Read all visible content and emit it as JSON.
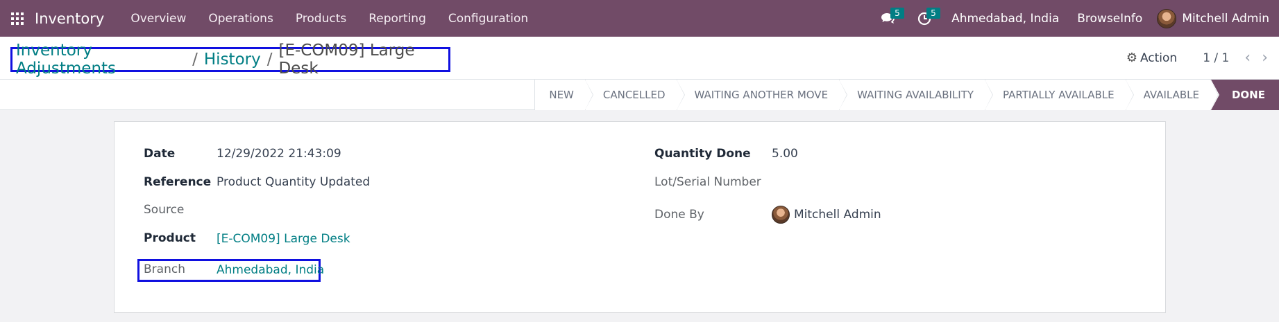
{
  "navbar": {
    "app_title": "Inventory",
    "menu": [
      "Overview",
      "Operations",
      "Products",
      "Reporting",
      "Configuration"
    ],
    "messages_badge": "5",
    "activities_badge": "5",
    "company": "Ahmedabad, India",
    "branch": "BrowseInfo",
    "user": "Mitchell Admin"
  },
  "breadcrumb": {
    "root": "Inventory Adjustments",
    "middle": "History",
    "current": "[E-COM09] Large Desk",
    "separator": "/"
  },
  "control": {
    "action_label": "Action",
    "pager": "1 / 1"
  },
  "statusbar": {
    "steps": [
      "NEW",
      "CANCELLED",
      "WAITING ANOTHER MOVE",
      "WAITING AVAILABILITY",
      "PARTIALLY AVAILABLE",
      "AVAILABLE",
      "DONE"
    ],
    "active": "DONE"
  },
  "form": {
    "date_label": "Date",
    "date_value": "12/29/2022 21:43:09",
    "reference_label": "Reference",
    "reference_value": "Product Quantity Updated",
    "source_label": "Source",
    "product_label": "Product",
    "product_value": "[E-COM09] Large Desk",
    "branch_label": "Branch",
    "branch_value": "Ahmedabad, India",
    "qty_label": "Quantity Done",
    "qty_value": "5.00",
    "lot_label": "Lot/Serial Number",
    "doneby_label": "Done By",
    "doneby_value": "Mitchell Admin"
  },
  "colors": {
    "brand": "#714b67",
    "link": "#017e84",
    "highlight_box": "#1010e0"
  }
}
